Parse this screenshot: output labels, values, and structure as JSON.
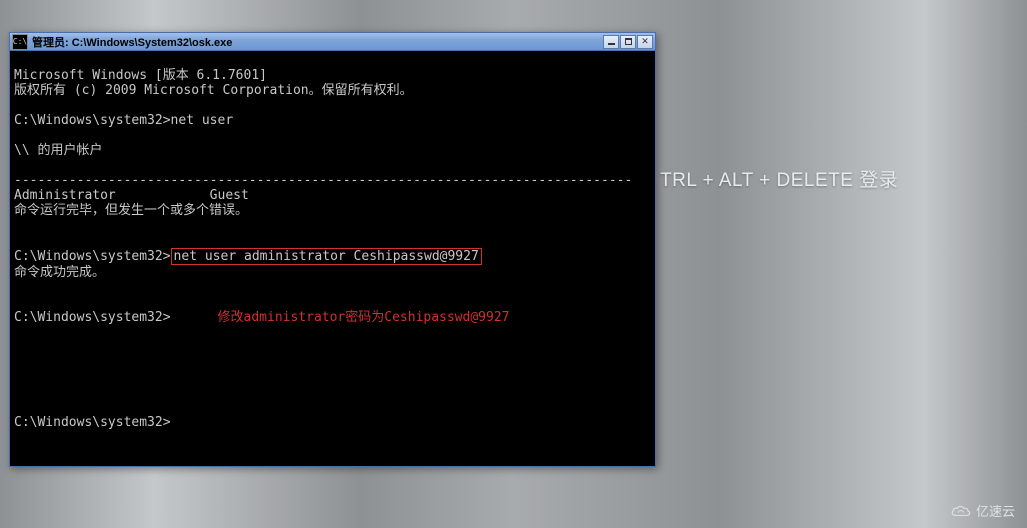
{
  "background": {
    "partial_text": "TRL + ALT + DELETE 登录"
  },
  "window": {
    "title": "管理员: C:\\Windows\\System32\\osk.exe",
    "icon_label": "C:\\"
  },
  "console": {
    "line_version": "Microsoft Windows [版本 6.1.7601]",
    "line_copyright": "版权所有 (c) 2009 Microsoft Corporation。保留所有权利。",
    "prompt1": "C:\\Windows\\system32>",
    "cmd1": "net user",
    "accounts_header": "\\\\ 的用户帐户",
    "divider": "-------------------------------------------------------------------------------",
    "account_admin": "Administrator",
    "account_guest": "Guest",
    "cmd1_result": "命令运行完毕，但发生一个或多个错误。",
    "prompt2": "C:\\Windows\\system32>",
    "cmd2": "net user administrator Ceshipasswd@9927",
    "cmd2_result": "命令成功完成。",
    "prompt3": "C:\\Windows\\system32>",
    "annotation": "修改administrator密码为Ceshipasswd@9927",
    "prompt4": "C:\\Windows\\system32>"
  },
  "watermark": {
    "text": "亿速云"
  }
}
